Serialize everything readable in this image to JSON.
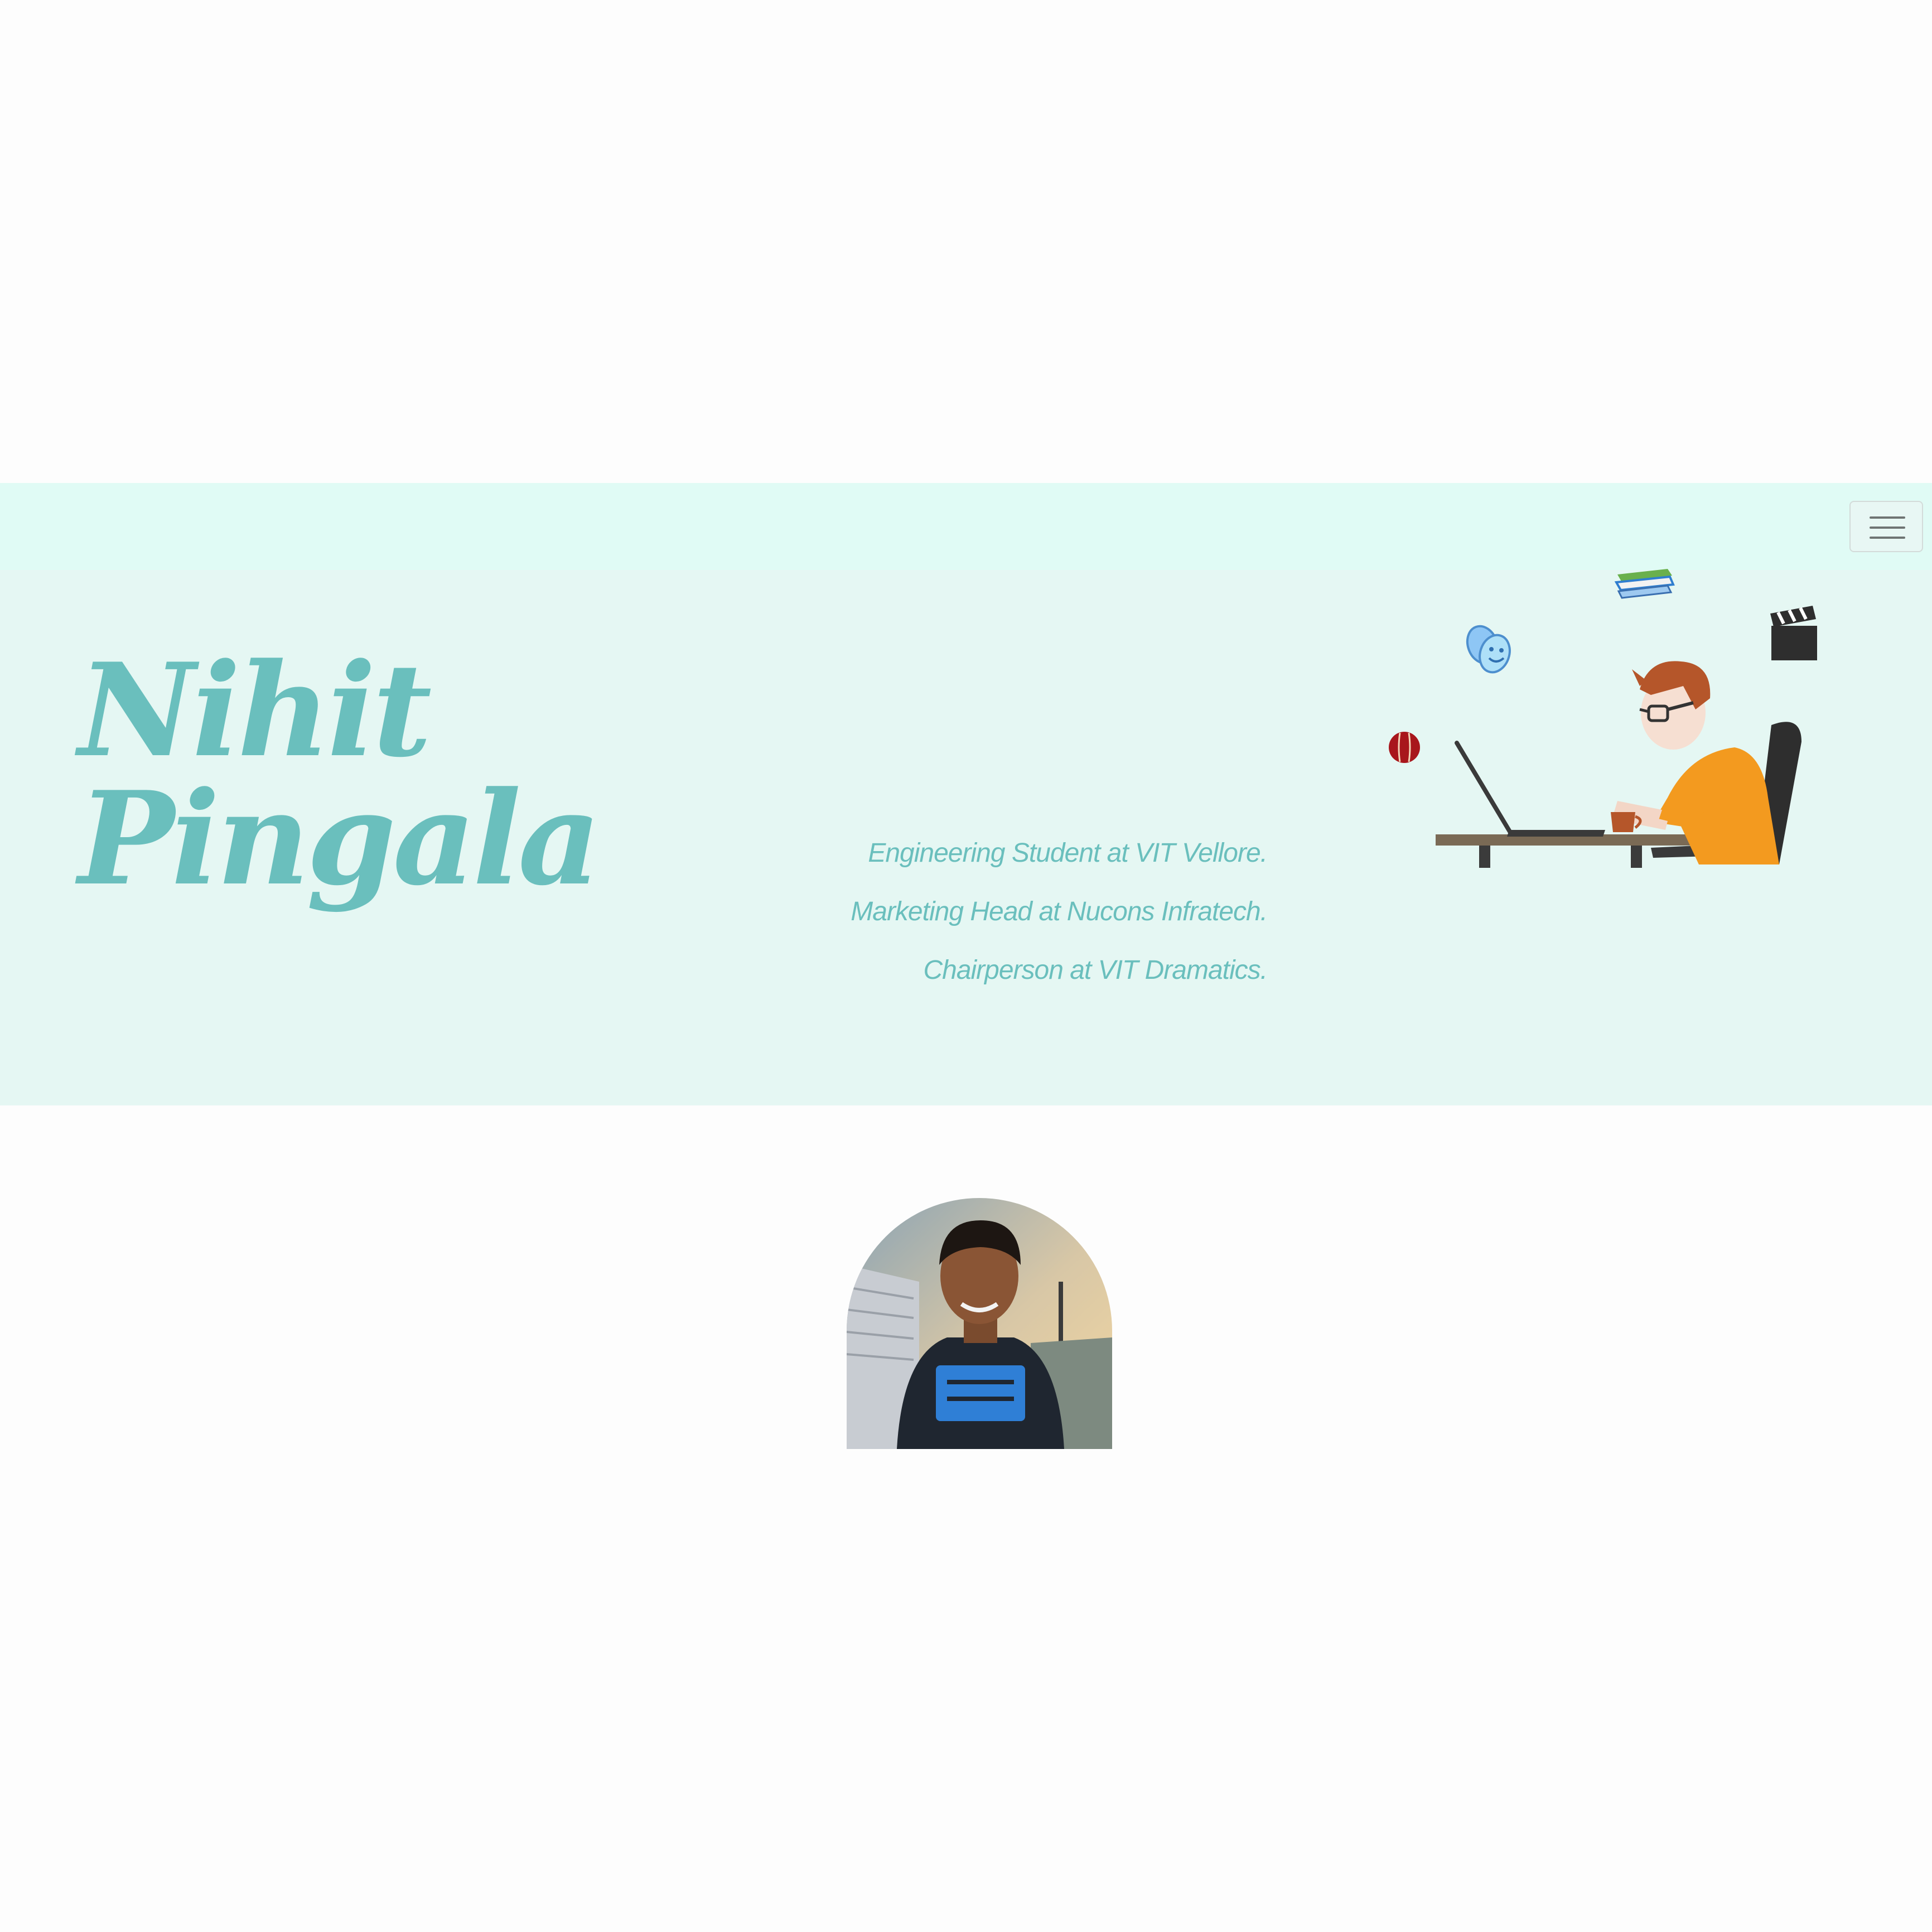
{
  "navbar": {
    "menu_toggle_icon": "hamburger-menu-icon",
    "background": "#e0fbf5"
  },
  "hero": {
    "name": "Nihit Pingala",
    "taglines": [
      "Engineering Student at VIT Vellore.",
      "Marketing Head at Nucons Infratech.",
      "Chairperson at VIT Dramatics."
    ],
    "illustration_icons": [
      "cricket-ball-icon",
      "theatre-masks-icon",
      "books-icon",
      "clapperboard-icon",
      "laptop-icon",
      "coffee-mug-icon"
    ],
    "accent_color": "#6abfbd",
    "background": "#e5f7f3"
  },
  "profile": {
    "avatar": "profile-photo"
  }
}
